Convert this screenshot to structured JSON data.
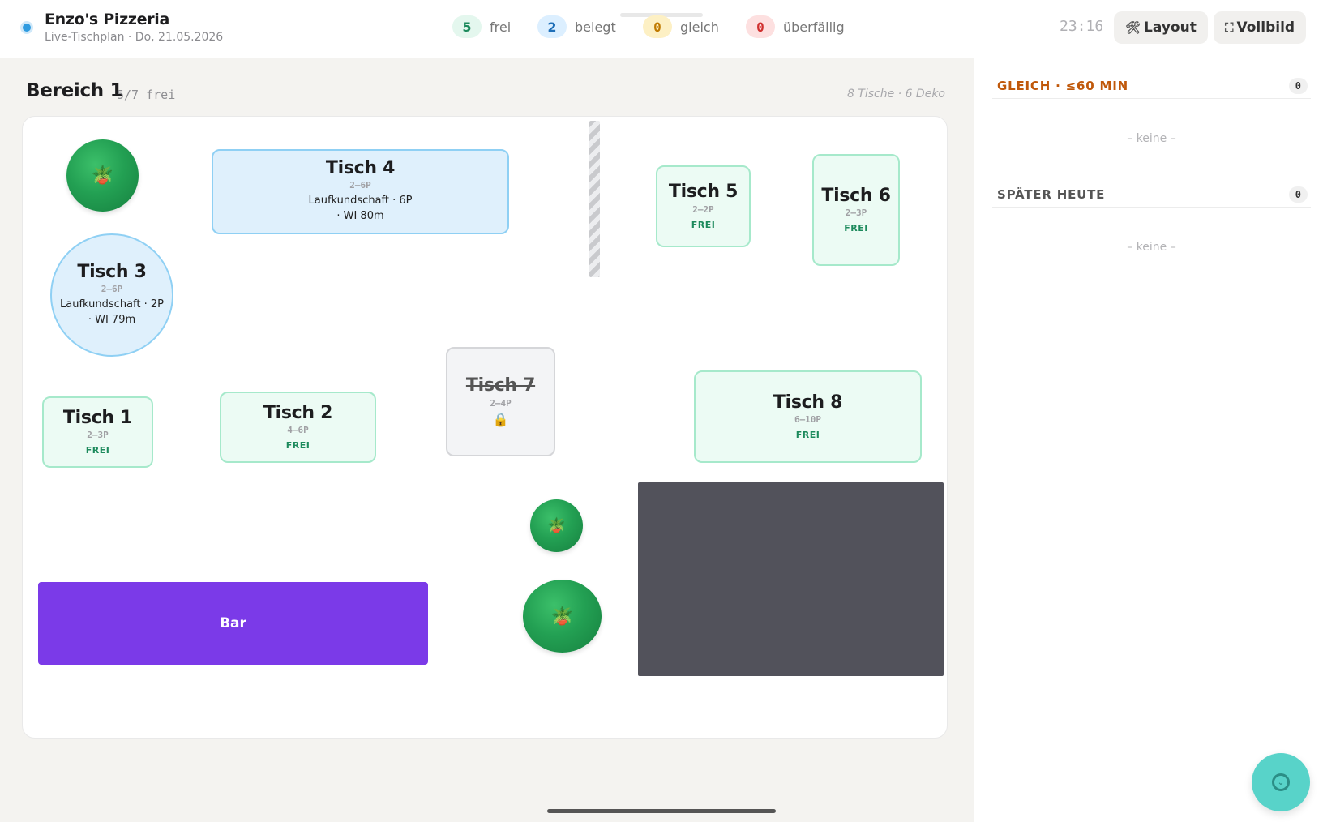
{
  "header": {
    "title": "Enzo's Pizzeria",
    "subtitle": "Live-Tischplan · Do, 21.05.2026",
    "stats": [
      {
        "count": "5",
        "label": "frei"
      },
      {
        "count": "2",
        "label": "belegt"
      },
      {
        "count": "0",
        "label": "gleich"
      },
      {
        "count": "0",
        "label": "überfällig"
      }
    ],
    "clock": "23:16",
    "layout_label": "Layout",
    "fullscreen_label": "Vollbild"
  },
  "area": {
    "title": "Bereich 1",
    "free": "5/7 frei",
    "meta": "8 Tische · 6 Deko"
  },
  "tables": {
    "t1": {
      "name": "Tisch 1",
      "capacity": "2–3P",
      "status": "FREI"
    },
    "t2": {
      "name": "Tisch 2",
      "capacity": "4–6P",
      "status": "FREI"
    },
    "t3": {
      "name": "Tisch 3",
      "capacity": "2–6P",
      "guest": "Laufkundschaft · 2P",
      "walkin": "· WI 79m"
    },
    "t4": {
      "name": "Tisch 4",
      "capacity": "2–6P",
      "guest": "Laufkundschaft · 6P",
      "walkin": "· WI 80m"
    },
    "t5": {
      "name": "Tisch 5",
      "capacity": "2–2P",
      "status": "FREI"
    },
    "t6": {
      "name": "Tisch 6",
      "capacity": "2–3P",
      "status": "FREI"
    },
    "t7": {
      "name": "Tisch 7",
      "capacity": "2–4P",
      "icon": "lock-icon"
    },
    "t8": {
      "name": "Tisch 8",
      "capacity": "6–10P",
      "status": "FREI"
    }
  },
  "decor": {
    "bar_label": "Bar",
    "plant_icon": "potted-plant-icon"
  },
  "side": {
    "section_now": {
      "title": "GLEICH · ≤60 MIN",
      "count": "0",
      "empty": "– keine –"
    },
    "section_later": {
      "title": "SPÄTER HEUTE",
      "count": "0",
      "empty": "– keine –"
    }
  },
  "colors": {
    "accent": "#2f9be0",
    "free": "#1c8a5c",
    "busy": "#1f6fb8",
    "soon": "#c0580a",
    "overdue": "#d0302f",
    "bar": "#7b3ae8",
    "fab": "#58d3c9"
  }
}
